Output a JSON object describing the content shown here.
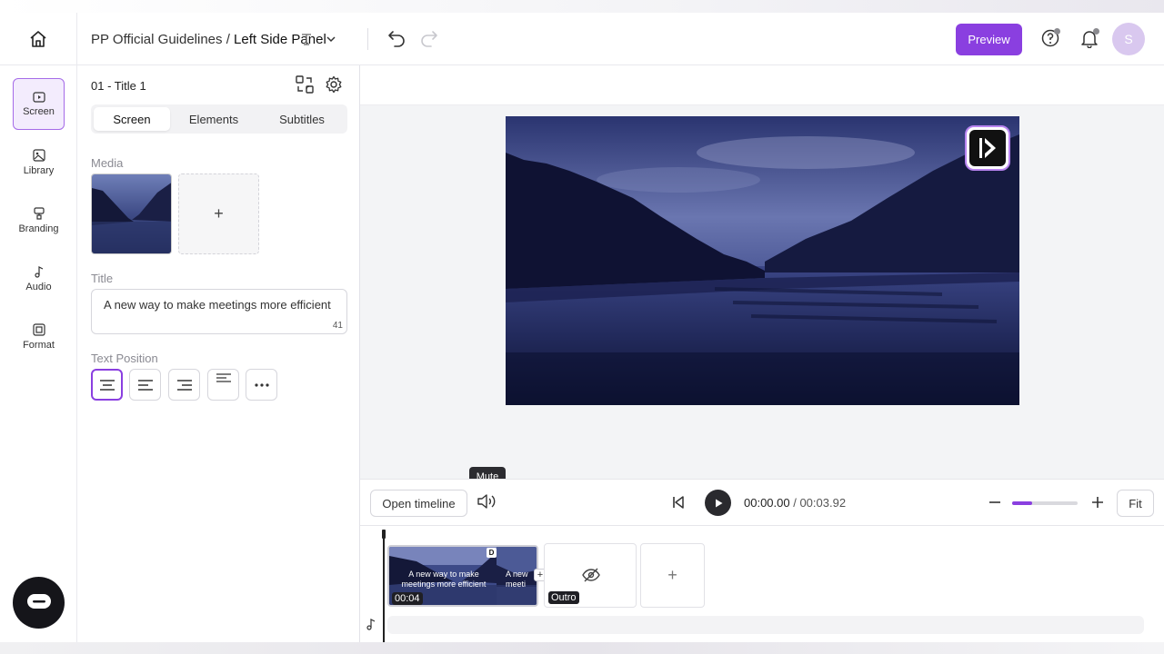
{
  "header": {
    "breadcrumb_parent": "PP Official Guidelines / ",
    "breadcrumb_current": "Left Side Panel",
    "preview_label": "Preview",
    "avatar_initial": "S"
  },
  "rail": {
    "items": [
      {
        "label": "Screen",
        "icon": "screen-icon",
        "active": true
      },
      {
        "label": "Library",
        "icon": "library-icon"
      },
      {
        "label": "Branding",
        "icon": "branding-icon"
      },
      {
        "label": "Audio",
        "icon": "music-note-icon"
      },
      {
        "label": "Format",
        "icon": "format-icon"
      }
    ]
  },
  "panel": {
    "scene_title": "01 - Title 1",
    "tabs": [
      {
        "label": "Screen",
        "active": true
      },
      {
        "label": "Elements"
      },
      {
        "label": "Subtitles"
      }
    ],
    "media_label": "Media",
    "media_add": "+",
    "title_label": "Title",
    "title_value": "A new way to make meetings more efficient",
    "title_char_count": "41",
    "text_position_label": "Text Position"
  },
  "controls": {
    "open_timeline_label": "Open timeline",
    "mute_tooltip": "Mute",
    "current_time": "00:00.00",
    "time_separator": " / ",
    "total_time": "00:03.92",
    "zoom_level": 0.3,
    "fit_label": "Fit"
  },
  "timeline": {
    "clip_text": "A new way to make meetings more efficient",
    "clip_text_partial": "A new meeti",
    "clip_duration": "00:04",
    "clip_badge": "D",
    "clip_add": "+",
    "outro_label": "Outro",
    "scene_add": "+"
  },
  "colors": {
    "accent": "#8a3fe0",
    "accent_soft": "#f3ecfd"
  }
}
